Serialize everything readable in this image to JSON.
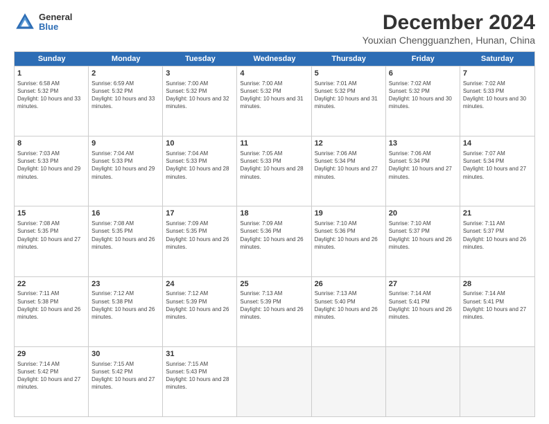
{
  "header": {
    "logo_line1": "General",
    "logo_line2": "Blue",
    "month": "December 2024",
    "location": "Youxian Chengguanzhen, Hunan, China"
  },
  "days_of_week": [
    "Sunday",
    "Monday",
    "Tuesday",
    "Wednesday",
    "Thursday",
    "Friday",
    "Saturday"
  ],
  "rows": [
    [
      {
        "day": 1,
        "rise": "6:58 AM",
        "set": "5:32 PM",
        "daylight": "10 hours and 33 minutes."
      },
      {
        "day": 2,
        "rise": "6:59 AM",
        "set": "5:32 PM",
        "daylight": "10 hours and 33 minutes."
      },
      {
        "day": 3,
        "rise": "7:00 AM",
        "set": "5:32 PM",
        "daylight": "10 hours and 32 minutes."
      },
      {
        "day": 4,
        "rise": "7:00 AM",
        "set": "5:32 PM",
        "daylight": "10 hours and 31 minutes."
      },
      {
        "day": 5,
        "rise": "7:01 AM",
        "set": "5:32 PM",
        "daylight": "10 hours and 31 minutes."
      },
      {
        "day": 6,
        "rise": "7:02 AM",
        "set": "5:32 PM",
        "daylight": "10 hours and 30 minutes."
      },
      {
        "day": 7,
        "rise": "7:02 AM",
        "set": "5:33 PM",
        "daylight": "10 hours and 30 minutes."
      }
    ],
    [
      {
        "day": 8,
        "rise": "7:03 AM",
        "set": "5:33 PM",
        "daylight": "10 hours and 29 minutes."
      },
      {
        "day": 9,
        "rise": "7:04 AM",
        "set": "5:33 PM",
        "daylight": "10 hours and 29 minutes."
      },
      {
        "day": 10,
        "rise": "7:04 AM",
        "set": "5:33 PM",
        "daylight": "10 hours and 28 minutes."
      },
      {
        "day": 11,
        "rise": "7:05 AM",
        "set": "5:33 PM",
        "daylight": "10 hours and 28 minutes."
      },
      {
        "day": 12,
        "rise": "7:06 AM",
        "set": "5:34 PM",
        "daylight": "10 hours and 27 minutes."
      },
      {
        "day": 13,
        "rise": "7:06 AM",
        "set": "5:34 PM",
        "daylight": "10 hours and 27 minutes."
      },
      {
        "day": 14,
        "rise": "7:07 AM",
        "set": "5:34 PM",
        "daylight": "10 hours and 27 minutes."
      }
    ],
    [
      {
        "day": 15,
        "rise": "7:08 AM",
        "set": "5:35 PM",
        "daylight": "10 hours and 27 minutes."
      },
      {
        "day": 16,
        "rise": "7:08 AM",
        "set": "5:35 PM",
        "daylight": "10 hours and 26 minutes."
      },
      {
        "day": 17,
        "rise": "7:09 AM",
        "set": "5:35 PM",
        "daylight": "10 hours and 26 minutes."
      },
      {
        "day": 18,
        "rise": "7:09 AM",
        "set": "5:36 PM",
        "daylight": "10 hours and 26 minutes."
      },
      {
        "day": 19,
        "rise": "7:10 AM",
        "set": "5:36 PM",
        "daylight": "10 hours and 26 minutes."
      },
      {
        "day": 20,
        "rise": "7:10 AM",
        "set": "5:37 PM",
        "daylight": "10 hours and 26 minutes."
      },
      {
        "day": 21,
        "rise": "7:11 AM",
        "set": "5:37 PM",
        "daylight": "10 hours and 26 minutes."
      }
    ],
    [
      {
        "day": 22,
        "rise": "7:11 AM",
        "set": "5:38 PM",
        "daylight": "10 hours and 26 minutes."
      },
      {
        "day": 23,
        "rise": "7:12 AM",
        "set": "5:38 PM",
        "daylight": "10 hours and 26 minutes."
      },
      {
        "day": 24,
        "rise": "7:12 AM",
        "set": "5:39 PM",
        "daylight": "10 hours and 26 minutes."
      },
      {
        "day": 25,
        "rise": "7:13 AM",
        "set": "5:39 PM",
        "daylight": "10 hours and 26 minutes."
      },
      {
        "day": 26,
        "rise": "7:13 AM",
        "set": "5:40 PM",
        "daylight": "10 hours and 26 minutes."
      },
      {
        "day": 27,
        "rise": "7:14 AM",
        "set": "5:41 PM",
        "daylight": "10 hours and 26 minutes."
      },
      {
        "day": 28,
        "rise": "7:14 AM",
        "set": "5:41 PM",
        "daylight": "10 hours and 27 minutes."
      }
    ],
    [
      {
        "day": 29,
        "rise": "7:14 AM",
        "set": "5:42 PM",
        "daylight": "10 hours and 27 minutes."
      },
      {
        "day": 30,
        "rise": "7:15 AM",
        "set": "5:42 PM",
        "daylight": "10 hours and 27 minutes."
      },
      {
        "day": 31,
        "rise": "7:15 AM",
        "set": "5:43 PM",
        "daylight": "10 hours and 28 minutes."
      },
      null,
      null,
      null,
      null
    ]
  ]
}
